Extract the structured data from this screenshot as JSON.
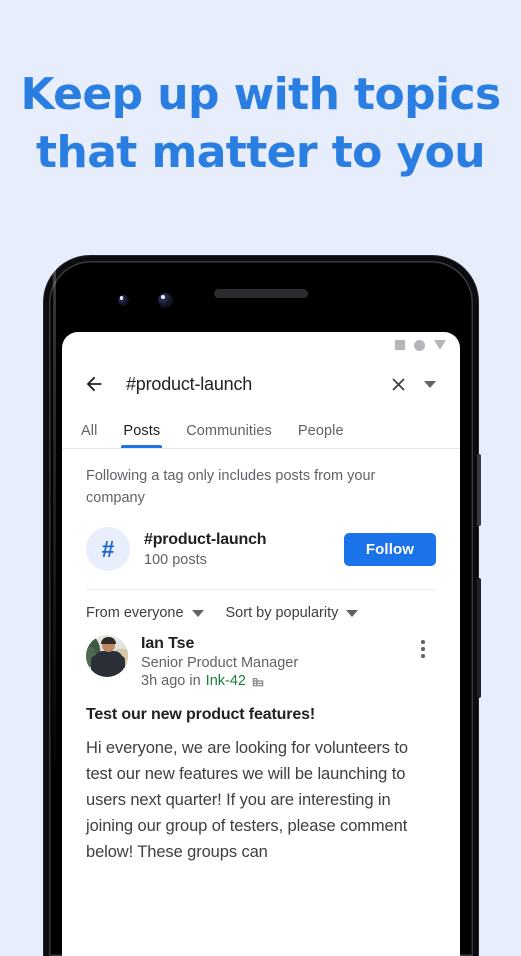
{
  "hero": {
    "line1": "Keep up with topics",
    "line2": "that matter to you",
    "color": "#2a7de1"
  },
  "background_color": "#e7edfb",
  "phone": {
    "status_icons": [
      "square-icon",
      "circle-icon",
      "triangle-icon"
    ],
    "hardware": [
      "earpiece-speaker",
      "front-camera-a",
      "front-camera-b",
      "power-button",
      "volume-button"
    ]
  },
  "appbar": {
    "back_icon": "back-arrow-icon",
    "query": "#product-launch",
    "close_icon": "close-icon",
    "dropdown_icon": "chevron-down-icon"
  },
  "tabs": [
    {
      "label": "All",
      "active": false
    },
    {
      "label": "Posts",
      "active": true
    },
    {
      "label": "Communities",
      "active": false
    },
    {
      "label": "People",
      "active": false
    }
  ],
  "notice": "Following a tag only includes posts from your company",
  "tag": {
    "icon": "#",
    "name": "#product-launch",
    "count": "100 posts",
    "follow_label": "Follow",
    "follow_color": "#1a73e8"
  },
  "filters": [
    {
      "label": "From everyone",
      "icon": "chevron-down-icon"
    },
    {
      "label": "Sort by popularity",
      "icon": "chevron-down-icon"
    }
  ],
  "post": {
    "author": "Ian Tse",
    "role": "Senior Product Manager",
    "time_prefix": "3h ago in",
    "org": "Ink-42",
    "org_color": "#188038",
    "org_icon": "building-icon",
    "more_icon": "overflow-menu-icon",
    "title": "Test our new product features!",
    "body": "Hi everyone, we are looking for volunteers to test our new features we will be launching to users next quarter! If you are interesting in joining our group of testers, please comment below! These groups can"
  }
}
